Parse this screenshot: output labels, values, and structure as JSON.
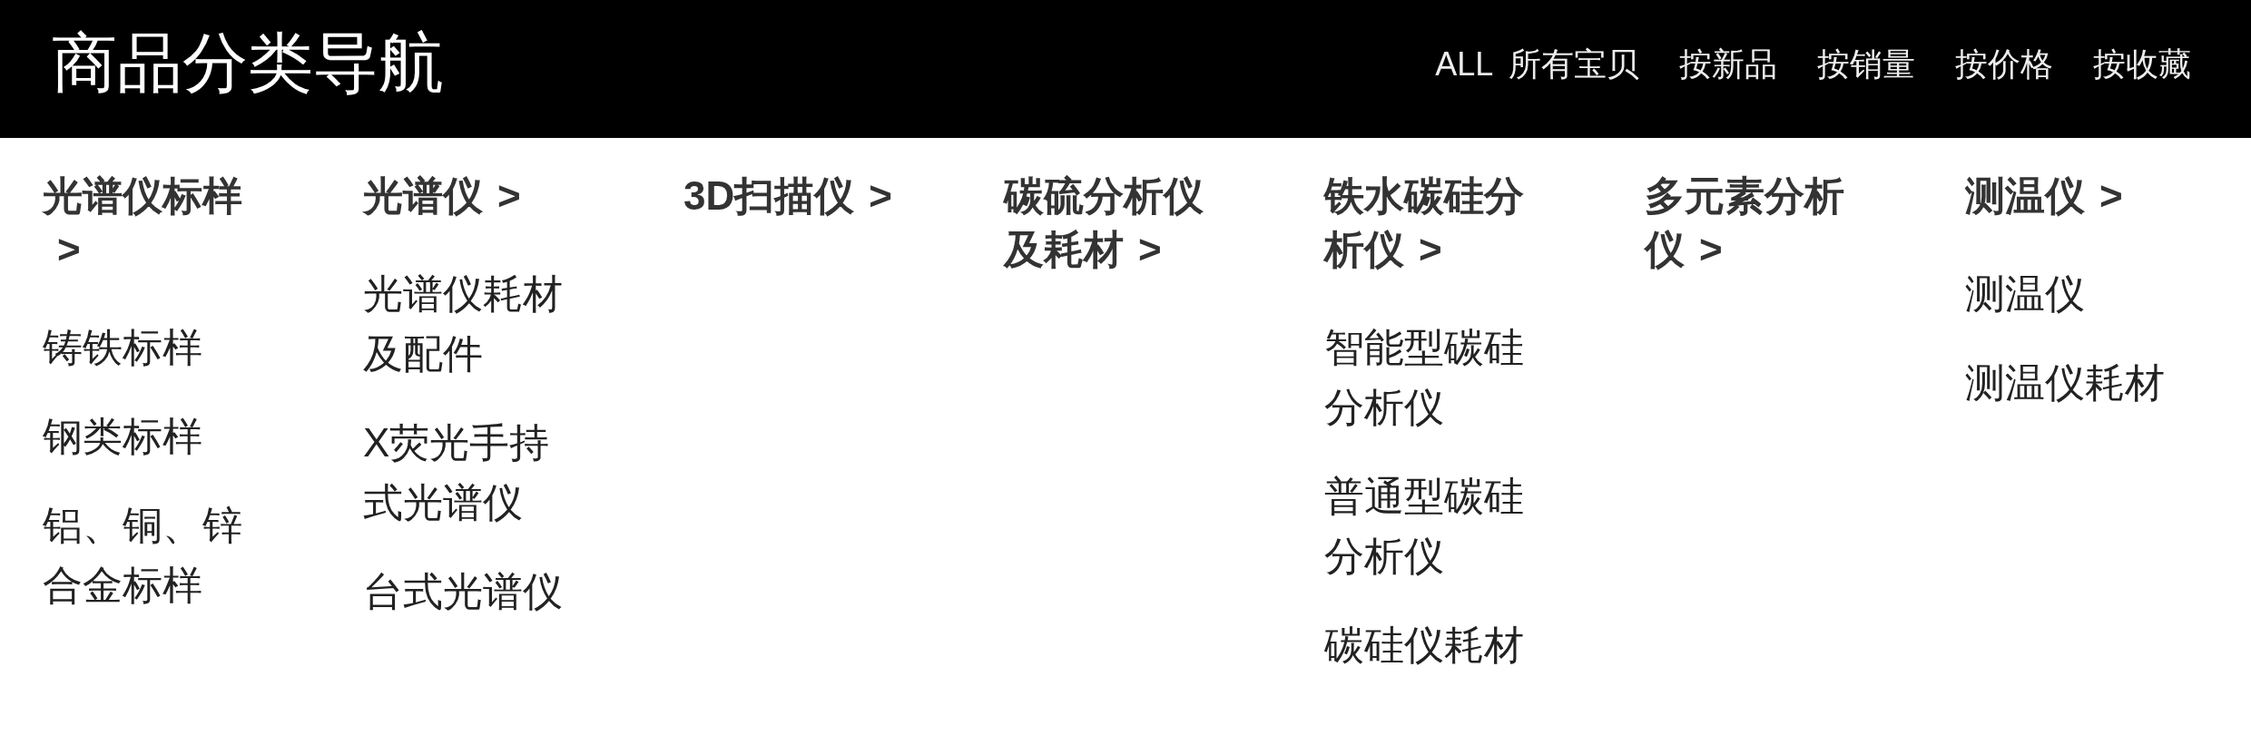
{
  "header": {
    "title": "商品分类导航",
    "nav": [
      {
        "label": "ALL 所有宝贝"
      },
      {
        "label": "按新品"
      },
      {
        "label": "按销量"
      },
      {
        "label": "按价格"
      },
      {
        "label": "按收藏"
      }
    ]
  },
  "categories": [
    {
      "title": "光谱仪标样",
      "chevron": ">",
      "items": [
        "铸铁标样",
        "钢类标样",
        "铝、铜、锌合金标样"
      ]
    },
    {
      "title": "光谱仪",
      "chevron": ">",
      "items": [
        "光谱仪耗材及配件",
        "X荧光手持式光谱仪",
        "台式光谱仪"
      ]
    },
    {
      "title": "3D扫描仪",
      "chevron": ">"
    },
    {
      "title": "碳硫分析仪及耗材",
      "chevron": ">"
    },
    {
      "title": "铁水碳硅分析仪",
      "chevron": ">",
      "items": [
        "智能型碳硅分析仪",
        "普通型碳硅分析仪",
        "碳硅仪耗材"
      ]
    },
    {
      "title": "多元素分析仪",
      "chevron": ">"
    },
    {
      "title": "测温仪",
      "chevron": ">",
      "items": [
        "测温仪",
        "测温仪耗材"
      ]
    }
  ]
}
